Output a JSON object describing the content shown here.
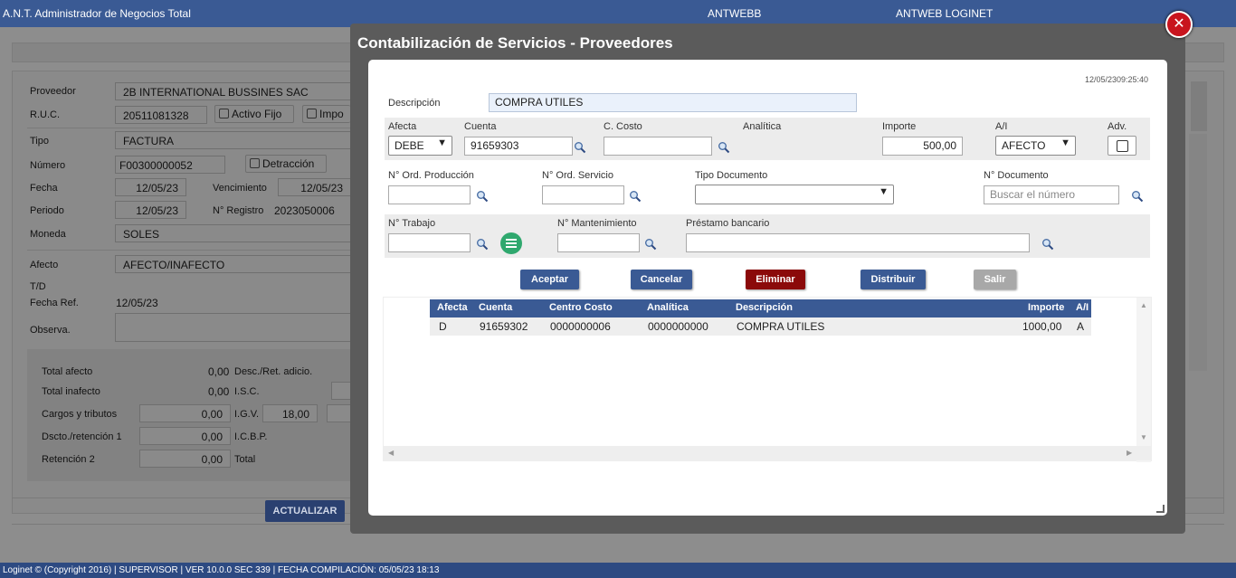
{
  "topbar": {
    "app_title": "A.N.T. Administrador de Negocios Total",
    "db_name": "ANTWEBB",
    "connection": "ANTWEB LOGINET"
  },
  "background": {
    "proveedor_label": "Proveedor",
    "proveedor_value": "2B INTERNATIONAL BUSSINES SAC",
    "ruc_label": "R.U.C.",
    "ruc_value": "20511081328",
    "activo_fijo_label": "Activo Fijo",
    "impo_label": "Impo",
    "tipo_label": "Tipo",
    "tipo_value": "FACTURA",
    "numero_label": "Número",
    "numero_value": "F00300000052",
    "detraccion_label": "Detracción",
    "fecha_label": "Fecha",
    "fecha_value": "12/05/23",
    "vencimiento_label": "Vencimiento",
    "vencimiento_value": "12/05/23",
    "periodo_label": "Periodo",
    "periodo_value": "12/05/23",
    "nregistro_label": "N° Registro",
    "nregistro_value": "2023050006",
    "moneda_label": "Moneda",
    "moneda_value": "SOLES",
    "afecto_label": "Afecto",
    "afecto_value": "AFECTO/INAFECTO",
    "td_label": "T/D",
    "fecha_ref_label": "Fecha Ref.",
    "fecha_ref_value": "12/05/23",
    "observa_label": "Observa.",
    "totals": {
      "total_afecto_label": "Total afecto",
      "total_afecto_value": "0,00",
      "desc_ret_label": "Desc./Ret. adicio.",
      "total_inafecto_label": "Total inafecto",
      "total_inafecto_value": "0,00",
      "isc_label": "I.S.C.",
      "cargos_label": "Cargos y tributos",
      "cargos_value": "0,00",
      "igv_label": "I.G.V.",
      "igv_value": "18,00",
      "dscto_label": "Dscto./retención 1",
      "dscto_value": "0,00",
      "icbp_label": "I.C.B.P.",
      "retencion2_label": "Retención 2",
      "retencion2_value": "0,00",
      "total_label": "Total"
    },
    "actualizar_label": "ACTUALIZAR"
  },
  "modal": {
    "title": "Contabilización de Servicios - Proveedores",
    "timestamp": "12/05/2309:25:40",
    "descripcion_label": "Descripción",
    "descripcion_value": "COMPRA UTILES",
    "afecta_label": "Afecta",
    "afecta_value": "DEBE",
    "cuenta_label": "Cuenta",
    "cuenta_value": "91659303",
    "ccosto_label": "C. Costo",
    "ccosto_value": "",
    "analitica_label": "Analítica",
    "importe_label": "Importe",
    "importe_value": "500,00",
    "ai_label": "A/I",
    "ai_value": "AFECTO",
    "adv_label": "Adv.",
    "ord_prod_label": "N° Ord. Producción",
    "ord_serv_label": "N° Ord. Servicio",
    "tipo_doc_label": "Tipo Documento",
    "tipo_doc_value": "",
    "ndoc_label": "N° Documento",
    "ndoc_placeholder": "Buscar el número",
    "ntrabajo_label": "N° Trabajo",
    "nmant_label": "N° Mantenimiento",
    "prestamo_label": "Préstamo bancario",
    "buttons": {
      "aceptar": "Aceptar",
      "cancelar": "Cancelar",
      "eliminar": "Eliminar",
      "distribuir": "Distribuir",
      "salir": "Salir"
    },
    "grid": {
      "headers": [
        "Afecta",
        "Cuenta",
        "Centro Costo",
        "Analítica",
        "Descripción",
        "Importe",
        "A/I"
      ],
      "rows": [
        [
          "D",
          "91659302",
          "0000000006",
          "0000000000",
          "COMPRA UTILES",
          "1000,00",
          "A"
        ]
      ]
    }
  },
  "statusbar": {
    "text": "Loginet © (Copyright 2016) | SUPERVISOR | VER 10.0.0 SEC 339 | FECHA COMPILACIÓN: 05/05/23 18:13"
  },
  "colors": {
    "brand_blue": "#3a5a94",
    "eliminar_red": "#8b0a0a",
    "salir_gray": "#a8a8a8",
    "close_red": "#c8141e",
    "menu_green": "#2fa86e"
  },
  "icons": [
    "search-icon",
    "close-icon",
    "menu-icon",
    "chevron-down-icon",
    "resize-handle-icon"
  ]
}
